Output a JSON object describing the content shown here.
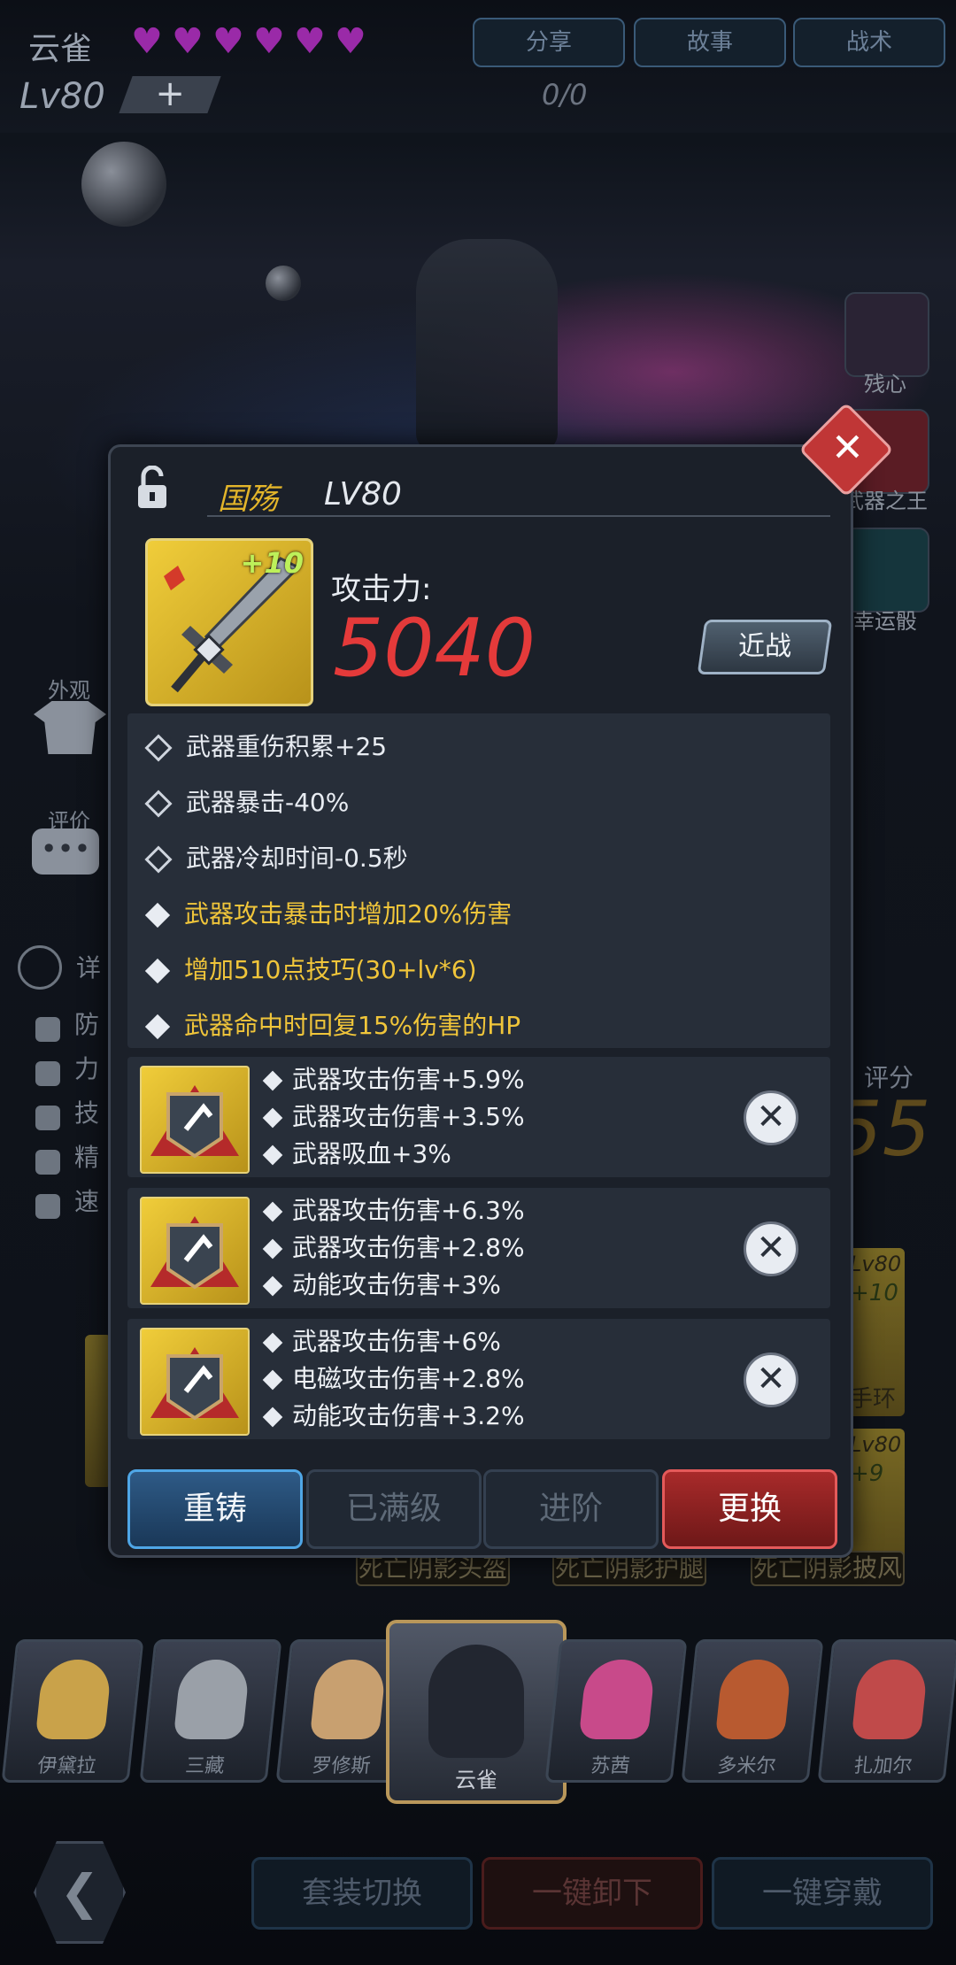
{
  "header": {
    "character_name": "云雀",
    "hearts": 6,
    "level": "Lv80",
    "plus": "+",
    "progress": "0/0",
    "tabs": [
      "分享",
      "故事",
      "战术"
    ]
  },
  "side_right": [
    "残心",
    "武器之王",
    "幸运骰"
  ],
  "side_left": {
    "appearance": "外观",
    "review": "评价",
    "detail": "详",
    "stats": [
      "防",
      "力",
      "技",
      "精",
      "速"
    ]
  },
  "score": {
    "label": "评分",
    "value": "55"
  },
  "bg_items": {
    "right_lv_1": "Lv80",
    "right_plus_1": "+10",
    "right_name_1": "手环",
    "right_lv_2": "Lv80",
    "right_plus_2": "+9",
    "labels": [
      "死亡阴影头盔",
      "死亡阴影护腿",
      "死亡阴影披风"
    ]
  },
  "dialog": {
    "weapon_name": "国殇",
    "weapon_level": "LV80",
    "enhance": "+10",
    "attack_label": "攻击力:",
    "attack_value": "5040",
    "type_button": "近战",
    "attributes": [
      {
        "text": "武器重伤积累+25",
        "style": "base"
      },
      {
        "text": "武器暴击-40%",
        "style": "base"
      },
      {
        "text": "武器冷却时间-0.5秒",
        "style": "base"
      },
      {
        "text": "武器攻击暴击时增加20%伤害",
        "style": "special"
      },
      {
        "text": "增加510点技巧(30+lv*6)",
        "style": "special"
      },
      {
        "text": "武器命中时回复15%伤害的HP",
        "style": "special"
      }
    ],
    "gems": [
      {
        "lines": [
          "武器攻击伤害+5.9%",
          "武器攻击伤害+3.5%",
          "武器吸血+3%"
        ]
      },
      {
        "lines": [
          "武器攻击伤害+6.3%",
          "武器攻击伤害+2.8%",
          "动能攻击伤害+3%"
        ]
      },
      {
        "lines": [
          "武器攻击伤害+6%",
          "电磁攻击伤害+2.8%",
          "动能攻击伤害+3.2%"
        ]
      }
    ],
    "buttons": {
      "reforge": "重铸",
      "maxed": "已满级",
      "advance": "进阶",
      "replace": "更换"
    },
    "close_glyph": "✕",
    "remove_glyph": "✕"
  },
  "roster": [
    "伊黛拉",
    "三藏",
    "罗修斯",
    "云雀",
    "苏茜",
    "多米尔",
    "扎加尔"
  ],
  "bottom": {
    "back_glyph": "❮",
    "suit_switch": "套装切换",
    "unequip_all": "一键卸下",
    "equip_all": "一键穿戴"
  },
  "colors": {
    "accent_gold": "#e3b52a",
    "attack_red": "#e43a3a",
    "special_yellow": "#f0c53a",
    "button_blue": "#4fa6e6",
    "button_red": "#e45a5a"
  }
}
